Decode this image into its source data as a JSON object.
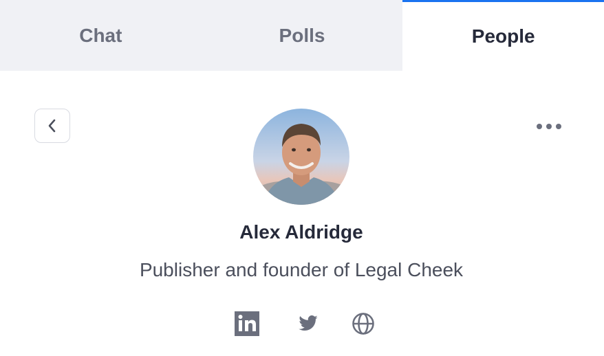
{
  "tabs": [
    {
      "label": "Chat",
      "active": false
    },
    {
      "label": "Polls",
      "active": false
    },
    {
      "label": "People",
      "active": true
    }
  ],
  "colors": {
    "accent": "#1a73f0",
    "inactive_tab_bg": "#f0f1f5",
    "text_dark": "#262a3a",
    "text_muted": "#4b4f5c",
    "icon": "#6b6f7d"
  },
  "profile": {
    "name": "Alex Aldridge",
    "title": "Publisher and founder of Legal Cheek",
    "avatar_icon": "user-photo"
  },
  "actions": {
    "back_icon": "chevron-left-icon",
    "more_icon": "more-horizontal-icon"
  },
  "social": [
    {
      "icon": "linkedin-icon"
    },
    {
      "icon": "twitter-icon"
    },
    {
      "icon": "globe-icon"
    }
  ]
}
